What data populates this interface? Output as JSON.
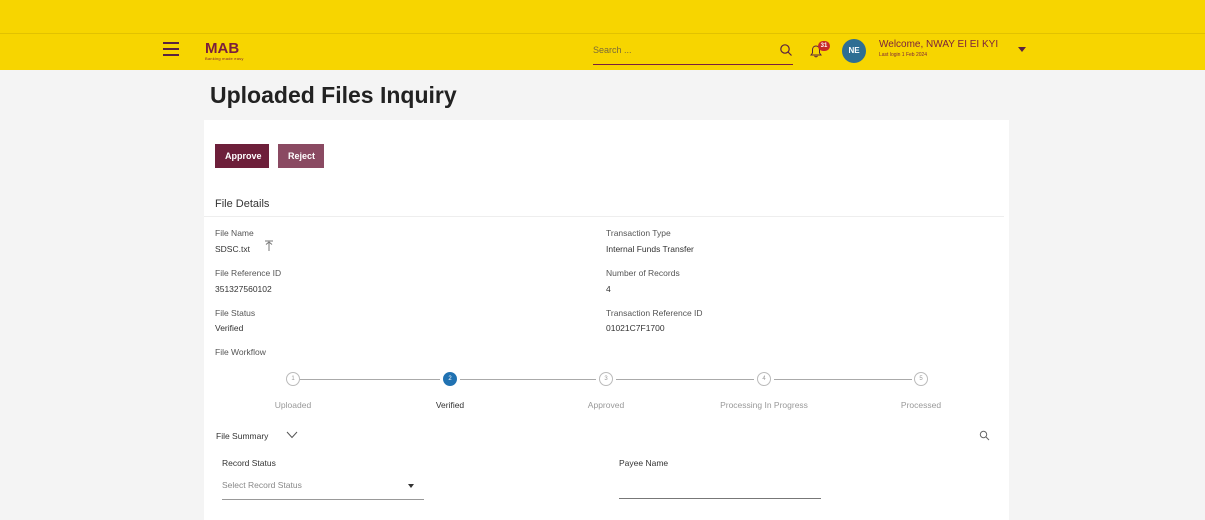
{
  "header": {
    "logo_text": "MAB",
    "logo_tagline": "Banking made easy",
    "search_placeholder": "Search ...",
    "notification_count": "31",
    "avatar_initials": "NE",
    "welcome_text": "Welcome, NWAY EI EI KYI",
    "last_login": "Last login 1 Feb 2024"
  },
  "page": {
    "title": "Uploaded Files Inquiry"
  },
  "actions": {
    "approve_label": "Approve",
    "reject_label": "Reject"
  },
  "file_details": {
    "section_title": "File Details",
    "file_name_label": "File Name",
    "file_name_value": "SDSC.txt",
    "transaction_type_label": "Transaction Type",
    "transaction_type_value": "Internal Funds Transfer",
    "file_reference_label": "File Reference ID",
    "file_reference_value": "351327560102",
    "number_of_records_label": "Number of Records",
    "number_of_records_value": "4",
    "file_status_label": "File Status",
    "file_status_value": "Verified",
    "transaction_reference_label": "Transaction Reference ID",
    "transaction_reference_value": "01021C7F1700",
    "workflow_label": "File Workflow"
  },
  "workflow": {
    "steps": [
      {
        "number": "1",
        "label": "Uploaded"
      },
      {
        "number": "2",
        "label": "Verified"
      },
      {
        "number": "3",
        "label": "Approved"
      },
      {
        "number": "4",
        "label": "Processing In Progress"
      },
      {
        "number": "5",
        "label": "Processed"
      }
    ],
    "active_step": 2
  },
  "file_summary": {
    "label": "File Summary",
    "record_status_label": "Record Status",
    "record_status_placeholder": "Select Record Status",
    "payee_name_label": "Payee Name"
  },
  "colors": {
    "brand_yellow": "#f7d500",
    "brand_maroon": "#6d1f3a",
    "active_step_blue": "#2172b2"
  }
}
